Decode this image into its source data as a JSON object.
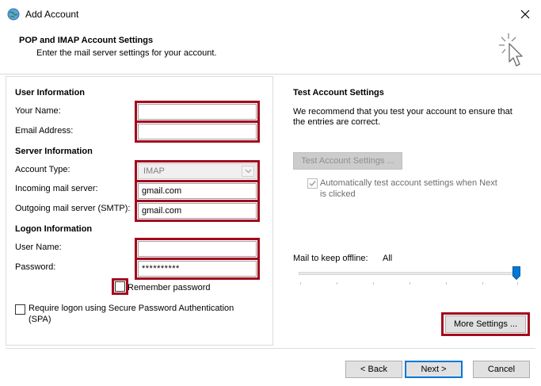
{
  "window": {
    "title": "Add Account",
    "close_icon": "close-icon"
  },
  "header": {
    "title": "POP and IMAP Account Settings",
    "subtitle": "Enter the mail server settings for your account."
  },
  "user_info": {
    "section": "User Information",
    "name_label": "Your Name:",
    "name_value": "",
    "email_label": "Email Address:",
    "email_value": ""
  },
  "server_info": {
    "section": "Server Information",
    "account_type_label": "Account Type:",
    "account_type_value": "IMAP",
    "incoming_label": "Incoming mail server:",
    "incoming_value": "gmail.com",
    "outgoing_label": "Outgoing mail server (SMTP):",
    "outgoing_value": "gmail.com"
  },
  "logon_info": {
    "section": "Logon Information",
    "username_label": "User Name:",
    "username_value": "",
    "password_label": "Password:",
    "password_value": "**********",
    "remember_label": "Remember password",
    "remember_checked": false
  },
  "spa": {
    "label_line1": "Require logon using Secure Password Authentication",
    "label_line2": "(SPA)",
    "checked": false
  },
  "test_settings": {
    "section": "Test Account Settings",
    "desc_line1": "We recommend that you test your account to ensure that",
    "desc_line2": "the entries are correct.",
    "button_label": "Test Account Settings ...",
    "auto_line1": "Automatically test account settings when Next",
    "auto_line2": "is clicked",
    "auto_checked": true
  },
  "offline": {
    "label": "Mail to keep offline:",
    "value": "All",
    "slider_level": 1.0
  },
  "more_settings_label": "More Settings ...",
  "footer": {
    "back_label": "< Back",
    "next_label": "Next >",
    "cancel_label": "Cancel"
  },
  "colors": {
    "highlight_outline": "#a3091d",
    "accent": "#0078d7"
  }
}
